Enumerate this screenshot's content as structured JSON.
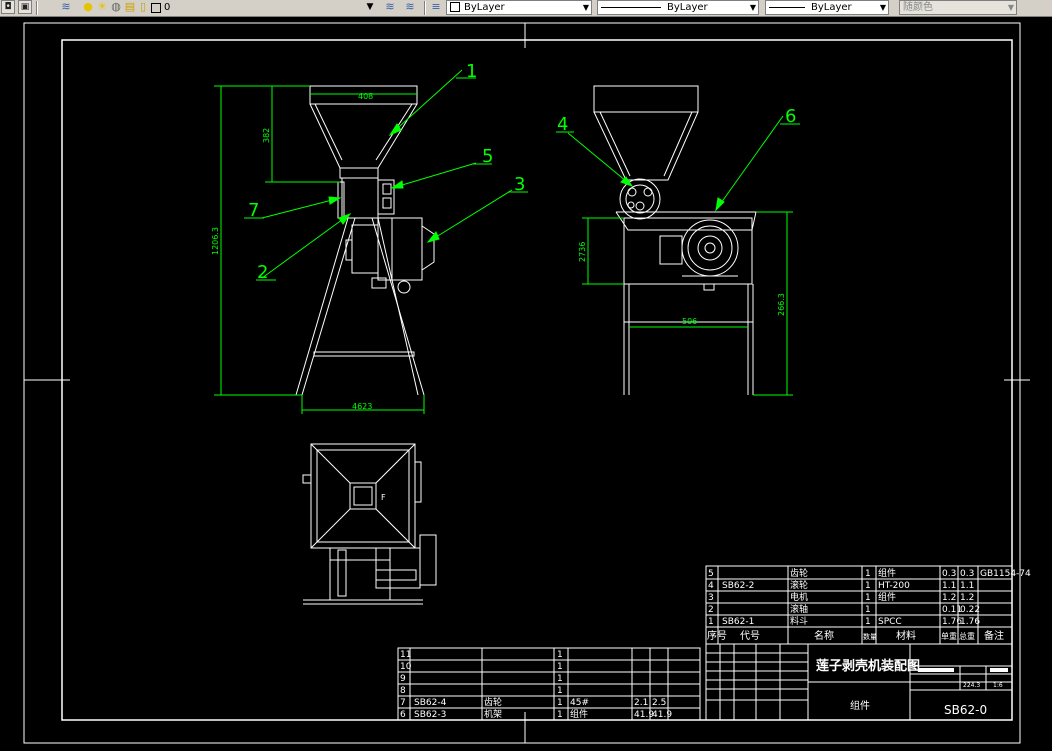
{
  "toolbar": {
    "layer_name": "0",
    "color_label": "ByLayer",
    "linetype_label": "ByLayer",
    "lineweight_label": "ByLayer",
    "plotstyle_label": "随颜色"
  },
  "drawing": {
    "callouts": [
      "1",
      "2",
      "3",
      "4",
      "5",
      "6",
      "7"
    ],
    "dims": {
      "front_width": "4623",
      "front_height": "1206.3",
      "hopper_width": "408",
      "hopper_depth": "382",
      "side_width": "506",
      "side_height": "2736",
      "side_height2": "266.3"
    },
    "top_view_mark": "F"
  },
  "bom": {
    "upper_rows": [
      {
        "no": "5",
        "code": "",
        "name": "齿轮",
        "qty": "1",
        "material": "组件",
        "w1": "0.3",
        "w2": "0.3",
        "note": "GB1154-74"
      },
      {
        "no": "4",
        "code": "SB62-2",
        "name": "滚轮",
        "qty": "1",
        "material": "HT-200",
        "w1": "1.1",
        "w2": "1.1",
        "note": ""
      },
      {
        "no": "3",
        "code": "",
        "name": "电机",
        "qty": "1",
        "material": "组件",
        "w1": "1.2",
        "w2": "1.2",
        "note": ""
      },
      {
        "no": "2",
        "code": "",
        "name": "滚轴",
        "qty": "1",
        "material": "",
        "w1": "0.11",
        "w2": "0.22",
        "note": ""
      },
      {
        "no": "1",
        "code": "SB62-1",
        "name": "料斗",
        "qty": "1",
        "material": "SPCC",
        "w1": "1.76",
        "w2": "1.76",
        "note": ""
      }
    ],
    "header": {
      "no": "序号",
      "code": "代号",
      "name": "名称",
      "qty": "数量",
      "material": "材料",
      "unit_w": "单重",
      "total_w": "总重",
      "note": "备注"
    },
    "lower_rows": [
      {
        "no": "11",
        "code": "",
        "name": "",
        "qty": "1",
        "material": "",
        "w1": "",
        "w2": ""
      },
      {
        "no": "10",
        "code": "",
        "name": "",
        "qty": "1",
        "material": "",
        "w1": "",
        "w2": ""
      },
      {
        "no": "9",
        "code": "",
        "name": "",
        "qty": "1",
        "material": "",
        "w1": "",
        "w2": ""
      },
      {
        "no": "8",
        "code": "",
        "name": "",
        "qty": "1",
        "material": "",
        "w1": "",
        "w2": ""
      },
      {
        "no": "7",
        "code": "SB62-4",
        "name": "齿轮",
        "qty": "1",
        "material": "45#",
        "w1": "2.1",
        "w2": "2.5"
      },
      {
        "no": "6",
        "code": "SB62-3",
        "name": "机架",
        "qty": "1",
        "material": "组件",
        "w1": "41.9",
        "w2": "41.9"
      }
    ]
  },
  "title_block": {
    "title": "莲子剥壳机装配图",
    "drawing_number": "SB62-0",
    "part_type": "组件",
    "scale": "1:6",
    "weight": "224.3"
  }
}
